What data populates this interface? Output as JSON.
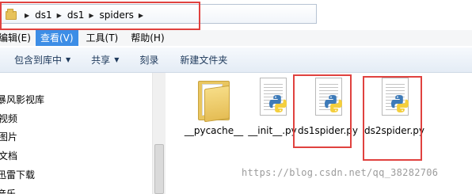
{
  "address_bar": {
    "path": [
      "ds1",
      "ds1",
      "spiders"
    ]
  },
  "menu": {
    "items": [
      {
        "label": "编辑(E)",
        "active": false
      },
      {
        "label": "查看(V)",
        "active": true
      },
      {
        "label": "工具(T)",
        "active": false
      },
      {
        "label": "帮助(H)",
        "active": false
      }
    ]
  },
  "toolbar": {
    "include_library": "包含到库中",
    "share": "共享",
    "burn": "刻录",
    "new_folder": "新建文件夹"
  },
  "nav": {
    "items": [
      "暴风影视库",
      "视频",
      "图片",
      "文档",
      "迅雷下载",
      "音乐"
    ]
  },
  "files": [
    {
      "name": "__pycache__",
      "type": "folder",
      "icon": "folder-icon"
    },
    {
      "name": "__init__.py",
      "type": "python",
      "icon": "python-file-icon"
    },
    {
      "name": "ds1spider.py",
      "type": "python",
      "icon": "python-file-icon"
    },
    {
      "name": "ds2spider.py",
      "type": "python",
      "icon": "python-file-icon"
    }
  ],
  "colors": {
    "highlight_box": "#e0423f",
    "menu_active": "#3c8de6",
    "folder": "#e9c660",
    "python_blue": "#3d7ab8",
    "python_yellow": "#f4cf3d"
  },
  "watermark": "https://blog.csdn.net/qq_38282706"
}
